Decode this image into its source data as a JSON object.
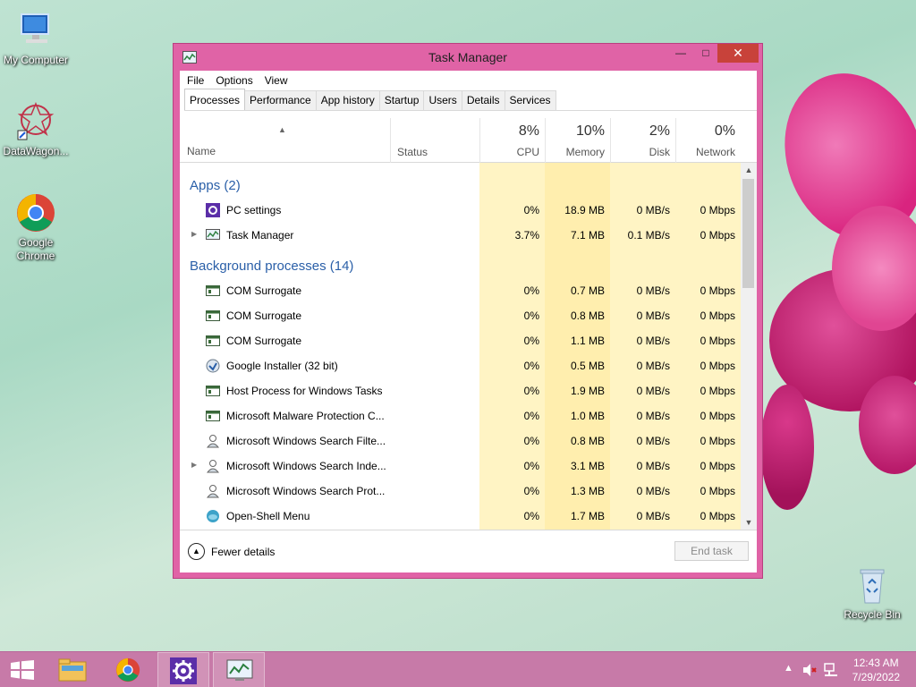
{
  "desktop": {
    "icons": [
      {
        "label": "My Computer"
      },
      {
        "label": "DataWagon..."
      },
      {
        "label": "Google Chrome"
      },
      {
        "label": "Recycle Bin"
      }
    ]
  },
  "window": {
    "title": "Task Manager",
    "menu": [
      "File",
      "Options",
      "View"
    ],
    "tabs": [
      "Processes",
      "Performance",
      "App history",
      "Startup",
      "Users",
      "Details",
      "Services"
    ],
    "active_tab": "Processes",
    "columns": {
      "name": "Name",
      "status": "Status",
      "cpu": {
        "label": "CPU",
        "pct": "8%"
      },
      "memory": {
        "label": "Memory",
        "pct": "10%"
      },
      "disk": {
        "label": "Disk",
        "pct": "2%"
      },
      "network": {
        "label": "Network",
        "pct": "0%"
      }
    },
    "groups": {
      "apps": "Apps (2)",
      "background": "Background processes (14)"
    },
    "apps": [
      {
        "name": "PC settings",
        "cpu": "0%",
        "mem": "18.9 MB",
        "disk": "0 MB/s",
        "net": "0 Mbps",
        "icon": "gear-icon",
        "expandable": false
      },
      {
        "name": "Task Manager",
        "cpu": "3.7%",
        "mem": "7.1 MB",
        "disk": "0.1 MB/s",
        "net": "0 Mbps",
        "icon": "task-manager-icon",
        "expandable": true
      }
    ],
    "background": [
      {
        "name": "COM Surrogate",
        "cpu": "0%",
        "mem": "0.7 MB",
        "disk": "0 MB/s",
        "net": "0 Mbps",
        "icon": "window-app-icon",
        "expandable": false
      },
      {
        "name": "COM Surrogate",
        "cpu": "0%",
        "mem": "0.8 MB",
        "disk": "0 MB/s",
        "net": "0 Mbps",
        "icon": "window-app-icon",
        "expandable": false
      },
      {
        "name": "COM Surrogate",
        "cpu": "0%",
        "mem": "1.1 MB",
        "disk": "0 MB/s",
        "net": "0 Mbps",
        "icon": "window-app-icon",
        "expandable": false
      },
      {
        "name": "Google Installer (32 bit)",
        "cpu": "0%",
        "mem": "0.5 MB",
        "disk": "0 MB/s",
        "net": "0 Mbps",
        "icon": "installer-icon",
        "expandable": false
      },
      {
        "name": "Host Process for Windows Tasks",
        "cpu": "0%",
        "mem": "1.9 MB",
        "disk": "0 MB/s",
        "net": "0 Mbps",
        "icon": "window-app-icon",
        "expandable": false
      },
      {
        "name": "Microsoft Malware Protection C...",
        "cpu": "0%",
        "mem": "1.0 MB",
        "disk": "0 MB/s",
        "net": "0 Mbps",
        "icon": "window-app-icon",
        "expandable": false
      },
      {
        "name": "Microsoft Windows Search Filte...",
        "cpu": "0%",
        "mem": "0.8 MB",
        "disk": "0 MB/s",
        "net": "0 Mbps",
        "icon": "search-user-icon",
        "expandable": false
      },
      {
        "name": "Microsoft Windows Search Inde...",
        "cpu": "0%",
        "mem": "3.1 MB",
        "disk": "0 MB/s",
        "net": "0 Mbps",
        "icon": "search-user-icon",
        "expandable": true
      },
      {
        "name": "Microsoft Windows Search Prot...",
        "cpu": "0%",
        "mem": "1.3 MB",
        "disk": "0 MB/s",
        "net": "0 Mbps",
        "icon": "search-user-icon",
        "expandable": false
      },
      {
        "name": "Open-Shell Menu",
        "cpu": "0%",
        "mem": "1.7 MB",
        "disk": "0 MB/s",
        "net": "0 Mbps",
        "icon": "shell-icon",
        "expandable": false
      }
    ],
    "footer": {
      "fewer_details": "Fewer details",
      "end_task": "End task"
    }
  },
  "taskbar": {
    "clock_time": "12:43 AM",
    "clock_date": "7/29/2022"
  },
  "colors": {
    "window_frame": "#e063a6",
    "close_button": "#c8423a",
    "group_text": "#2a5fa8",
    "heat_light": "#fff4c4",
    "heat_mid": "#ffeeae",
    "taskbar": "#c77aa8"
  }
}
